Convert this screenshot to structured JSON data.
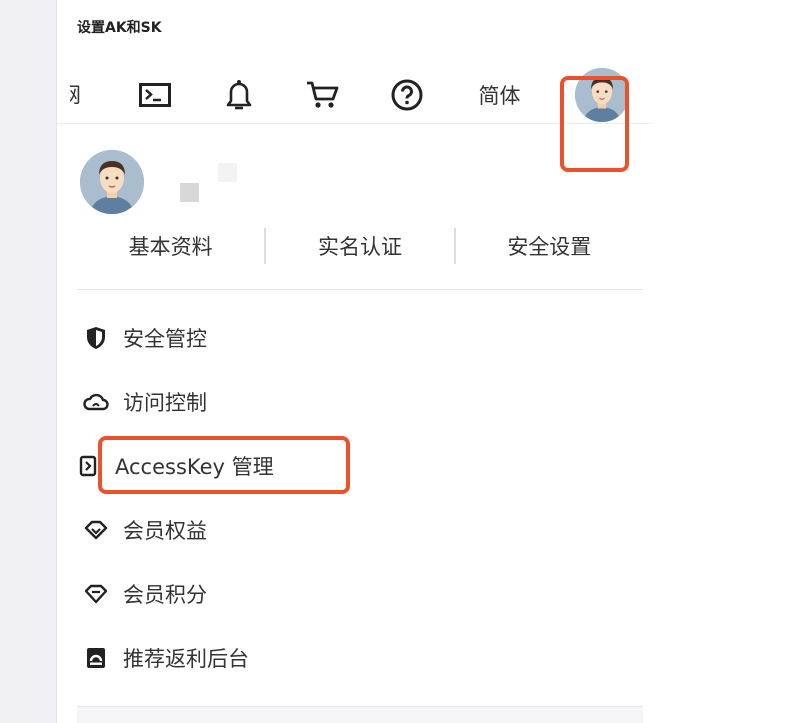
{
  "doc": {
    "title": "设置AK和SK"
  },
  "topbar": {
    "partial_label": "网",
    "icons": [
      "terminal-icon",
      "bell-icon",
      "cart-icon",
      "help-icon"
    ],
    "lang_label": "简体"
  },
  "user_panel": {
    "tabs": [
      "基本资料",
      "实名认证",
      "安全设置"
    ]
  },
  "menu": {
    "items": [
      {
        "label": "安全管控",
        "icon": "shield-icon"
      },
      {
        "label": "访问控制",
        "icon": "cloud-icon"
      },
      {
        "label": "AccessKey 管理",
        "icon": "key-icon"
      },
      {
        "label": "会员权益",
        "icon": "diamond-icon"
      },
      {
        "label": "会员积分",
        "icon": "gem-icon"
      },
      {
        "label": "推荐返利后台",
        "icon": "dashboard-icon"
      }
    ]
  },
  "colors": {
    "highlight": "#e9522a",
    "text": "#333333"
  }
}
